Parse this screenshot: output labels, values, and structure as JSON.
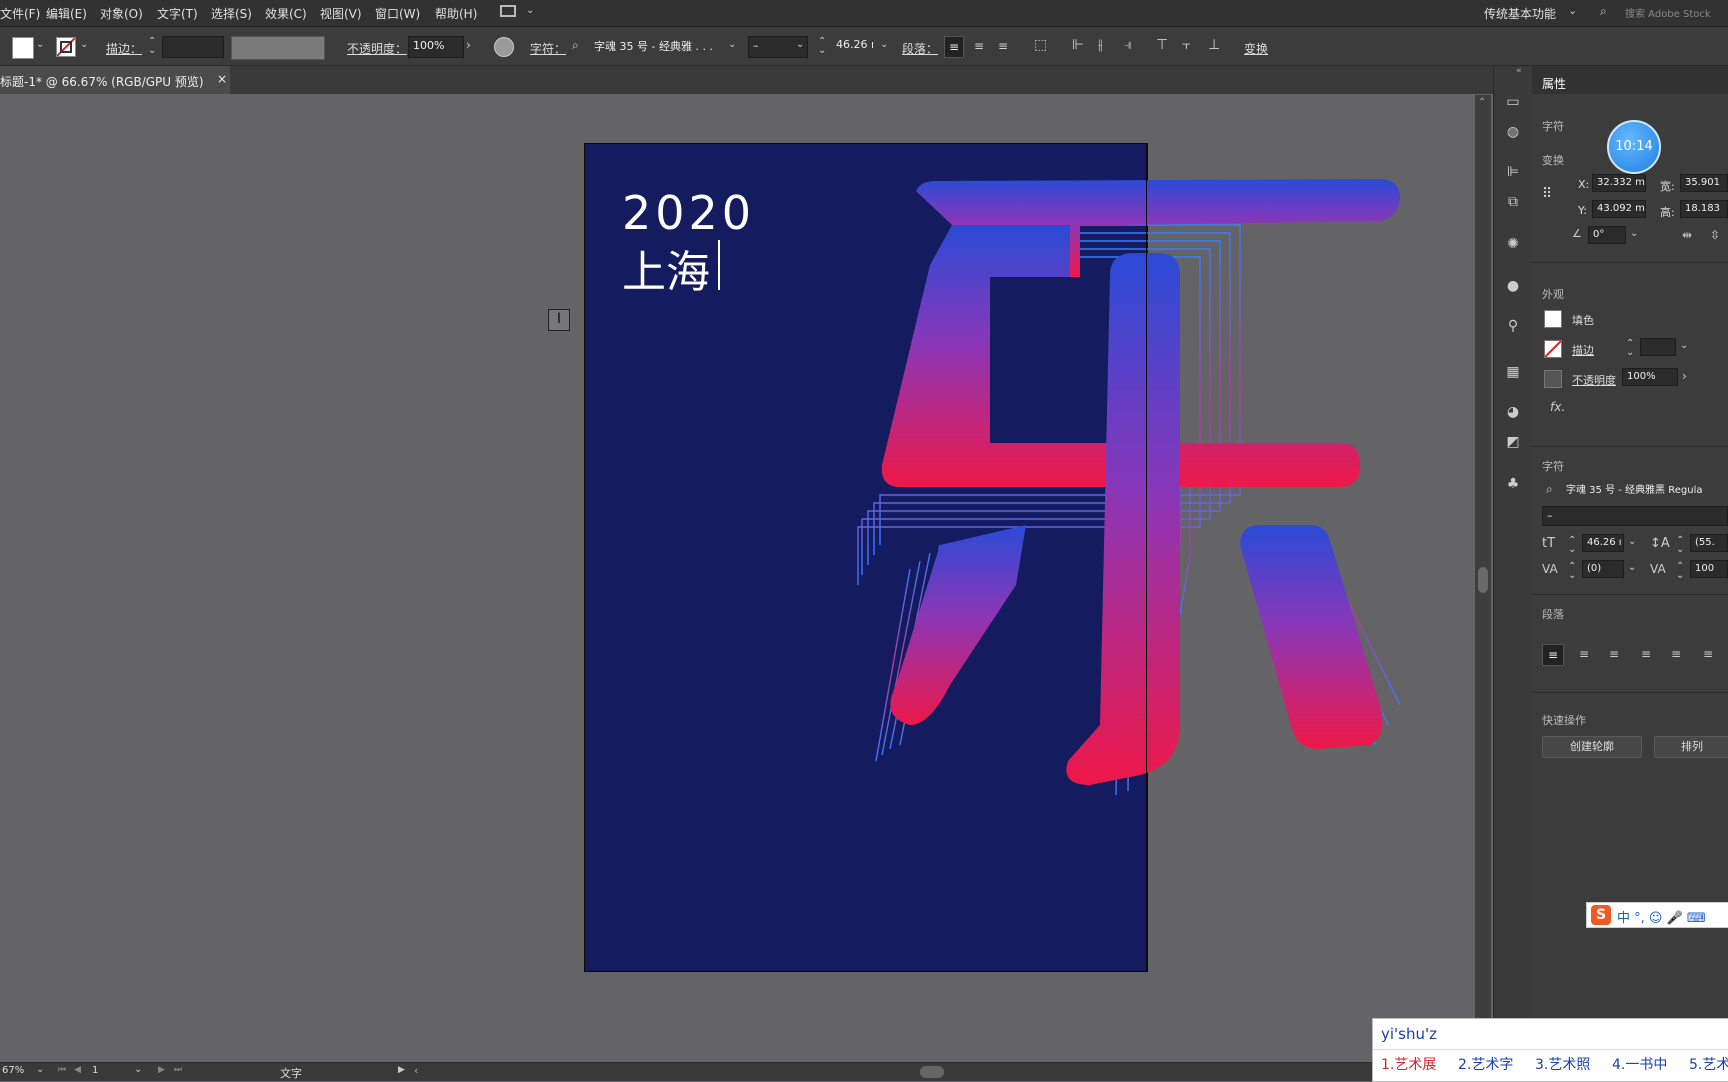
{
  "menubar": {
    "items": [
      "文件(F)",
      "编辑(E)",
      "对象(O)",
      "文字(T)",
      "选择(S)",
      "效果(C)",
      "视图(V)",
      "窗口(W)",
      "帮助(H)"
    ],
    "workspace": "传统基本功能",
    "search_placeholder": "搜索 Adobe Stock"
  },
  "controlbar": {
    "stroke_label": "描边：",
    "opacity_label": "不透明度：",
    "opacity_value": "100%",
    "char_label": "字符：",
    "font_name": "字魂 35 号 - 经典雅 . . .",
    "font_style": "–",
    "font_size": "46.26 ı",
    "para_label": "段落：",
    "transform_label": "变换"
  },
  "document": {
    "tab_title": "标题-1* @ 66.67% (RGB/GPU 预览)",
    "close": "×"
  },
  "artwork": {
    "year": "2020",
    "city": "上海",
    "big_char": "乐",
    "colors": {
      "bg": "#141b5e",
      "blue": "#2a4bd6",
      "pink": "#e8184f",
      "purple": "#8a36b8"
    }
  },
  "panel": {
    "title": "属性",
    "sec_char_top": "字符",
    "sec_transform": "变换",
    "x_label": "X:",
    "x_value": "32.332 m",
    "y_label": "Y:",
    "y_value": "43.092 m",
    "w_label": "宽:",
    "w_value": "35.901",
    "h_label": "高:",
    "h_value": "18.183",
    "angle_value": "0°",
    "sec_appearance": "外观",
    "fill_label": "填色",
    "stroke_label": "描边",
    "opacity_label": "不透明度",
    "opacity_value": "100%",
    "fx": "fx.",
    "sec_char": "字符",
    "font_name": "字魂 35 号 - 经典雅黑 Regula",
    "font_style": "–",
    "size_value": "46.26 ı",
    "leading_value": "(55.",
    "kerning_value": "(0)",
    "tracking_value": "100",
    "sec_para": "段落",
    "sec_quick": "快速操作",
    "btn_outline": "创建轮廓",
    "btn_arrange": "排列"
  },
  "clock": "10:14",
  "statusbar": {
    "zoom": "67%",
    "page": "1",
    "tool": "文字"
  },
  "ime": {
    "input": "yi'shu'z",
    "candidates": [
      "1.艺术展",
      "2.艺术字",
      "3.艺术照",
      "4.一书中",
      "5.艺术"
    ],
    "toolbar": "中 °, ☺ 🎤 ⌨"
  }
}
